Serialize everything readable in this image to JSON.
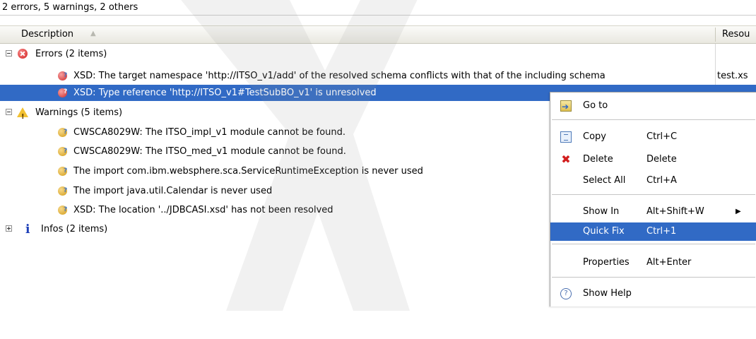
{
  "summary": "2 errors, 5 warnings, 2 others",
  "columns": {
    "description": "Description",
    "resource": "Resou"
  },
  "rows": [
    {
      "kind": "group",
      "icon": "error-icon",
      "text": "Errors (2 items)"
    },
    {
      "kind": "item",
      "icon": "error-quickfix-icon",
      "text": "XSD: The target namespace 'http://ITSO_v1/add' of the resolved schema conflicts with that of the including schema",
      "resource": "test.xs"
    },
    {
      "kind": "item",
      "icon": "error-quickfix-icon",
      "text": "XSD: Type reference 'http://ITSO_v1#TestSubBO_v1' is unresolved",
      "resource": ""
    },
    {
      "kind": "group",
      "icon": "warning-icon",
      "text": "Warnings (5 items)"
    },
    {
      "kind": "item",
      "icon": "warning-quickfix-icon",
      "text": "CWSCA8029W: The ITSO_impl_v1 module cannot be found.",
      "resource": ""
    },
    {
      "kind": "item",
      "icon": "warning-quickfix-icon",
      "text": "CWSCA8029W: The ITSO_med_v1 module cannot be found.",
      "resource": ""
    },
    {
      "kind": "item",
      "icon": "warning-quickfix-icon",
      "text": "The import com.ibm.websphere.sca.ServiceRuntimeException is never used",
      "resource": ""
    },
    {
      "kind": "item",
      "icon": "warning-quickfix-icon",
      "text": "The import java.util.Calendar is never used",
      "resource": ""
    },
    {
      "kind": "item",
      "icon": "warning-quickfix-icon",
      "text": "XSD: The location '../JDBCASI.xsd' has not been resolved",
      "resource": ""
    },
    {
      "kind": "group",
      "icon": "info-icon",
      "text": "Infos (2 items)"
    }
  ],
  "context_menu": {
    "items": [
      {
        "label": "Go to",
        "accel": "",
        "icon": "goto-icon"
      },
      {
        "label": "Copy",
        "accel": "Ctrl+C",
        "icon": "copy-icon"
      },
      {
        "label": "Delete",
        "accel": "Delete",
        "icon": "delete-icon"
      },
      {
        "label": "Select All",
        "accel": "Ctrl+A",
        "icon": ""
      },
      {
        "label": "Show In",
        "accel": "Alt+Shift+W",
        "icon": "",
        "submenu": "▶"
      },
      {
        "label": "Quick Fix",
        "accel": "Ctrl+1",
        "icon": "",
        "highlighted": true
      },
      {
        "label": "Properties",
        "accel": "Alt+Enter",
        "icon": ""
      },
      {
        "label": "Show Help",
        "accel": "",
        "icon": "help-icon"
      }
    ]
  },
  "colors": {
    "selection": "#316ac5",
    "header_bg": "#e9e8e0",
    "error": "#d42020",
    "warning": "#f2c133",
    "info": "#1d3fb8"
  }
}
